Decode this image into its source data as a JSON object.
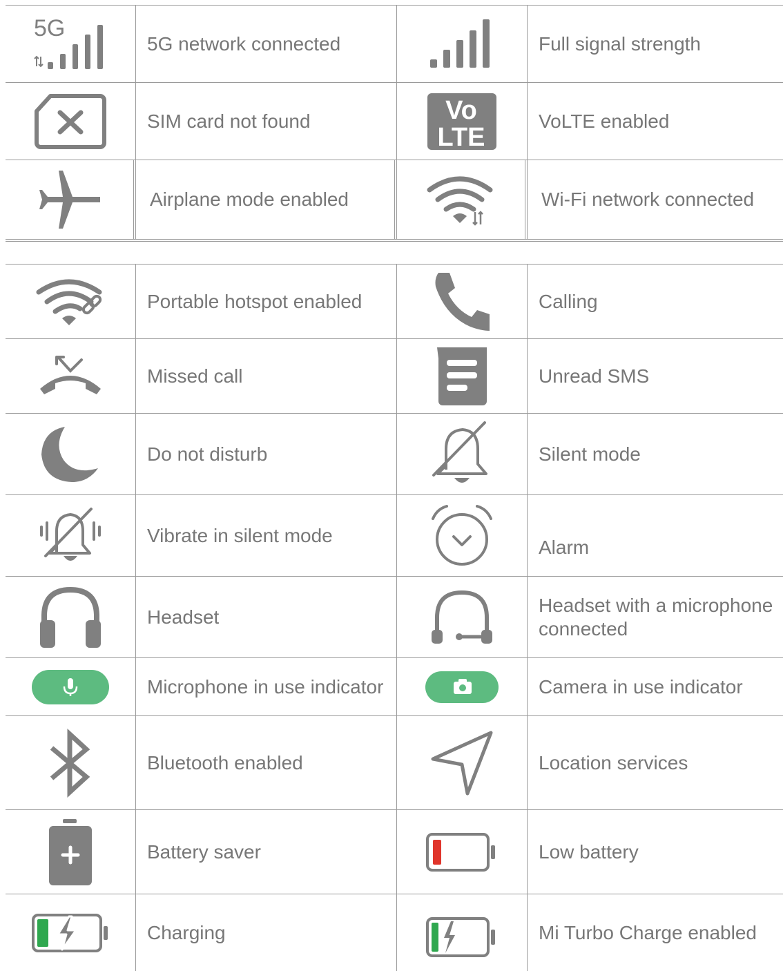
{
  "colors": {
    "icon": "#808080",
    "text": "#777777",
    "indicator_green": "#5dbb80",
    "battery_red": "#e0352b",
    "battery_green": "#2fa84f"
  },
  "table1": {
    "rows": [
      {
        "left": {
          "icon": "5g-network-icon",
          "badge": "5G",
          "label": "5G network connected"
        },
        "right": {
          "icon": "signal-strength-icon",
          "label": "Full signal strength"
        }
      },
      {
        "left": {
          "icon": "sim-card-missing-icon",
          "label": "SIM card not found"
        },
        "right": {
          "icon": "volte-icon",
          "badge_top": "Vo",
          "badge_bottom": "LTE",
          "label": "VoLTE enabled"
        }
      },
      {
        "left": {
          "icon": "airplane-icon",
          "label": "Airplane mode enabled"
        },
        "right": {
          "icon": "wifi-icon",
          "label": "Wi-Fi network connected"
        }
      }
    ]
  },
  "table2": {
    "rows": [
      {
        "left": {
          "icon": "hotspot-icon",
          "label": "Portable hotspot enabled"
        },
        "right": {
          "icon": "phone-icon",
          "label": "Calling"
        }
      },
      {
        "left": {
          "icon": "missed-call-icon",
          "label": "Missed call"
        },
        "right": {
          "icon": "sms-icon",
          "label": "Unread SMS"
        }
      },
      {
        "left": {
          "icon": "moon-icon",
          "label": "Do not disturb"
        },
        "right": {
          "icon": "bell-off-icon",
          "label": "Silent mode"
        }
      },
      {
        "left": {
          "icon": "vibrate-silent-icon",
          "label": "Vibrate in silent mode"
        },
        "right": {
          "icon": "alarm-icon",
          "label": "Alarm"
        }
      },
      {
        "left": {
          "icon": "headset-icon",
          "label": "Headset"
        },
        "right": {
          "icon": "headset-mic-icon",
          "label": "Headset with a microphone connected"
        }
      },
      {
        "left": {
          "icon": "microphone-indicator-icon",
          "label": "Microphone in use indicator"
        },
        "right": {
          "icon": "camera-indicator-icon",
          "label": "Camera in use indicator"
        }
      },
      {
        "left": {
          "icon": "bluetooth-icon",
          "label": "Bluetooth enabled"
        },
        "right": {
          "icon": "location-icon",
          "label": "Location services"
        }
      },
      {
        "left": {
          "icon": "battery-saver-icon",
          "label": "Battery saver"
        },
        "right": {
          "icon": "low-battery-icon",
          "label": "Low battery"
        }
      },
      {
        "left": {
          "icon": "charging-icon",
          "label": "Charging"
        },
        "right": {
          "icon": "turbo-charge-icon",
          "label": "Mi Turbo Charge enabled"
        }
      }
    ]
  }
}
